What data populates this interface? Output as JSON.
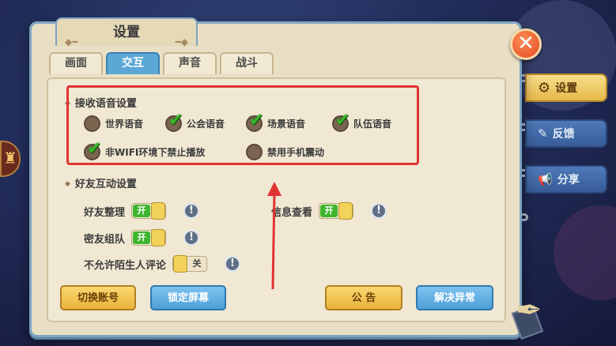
{
  "title": "设置",
  "tabs": [
    {
      "label": "画面",
      "active": false
    },
    {
      "label": "交互",
      "active": true
    },
    {
      "label": "声音",
      "active": false
    },
    {
      "label": "战斗",
      "active": false
    }
  ],
  "voice_section": {
    "title": "接收语音设置",
    "options": [
      {
        "label": "世界语音",
        "checked": false
      },
      {
        "label": "公会语音",
        "checked": true
      },
      {
        "label": "场景语音",
        "checked": true
      },
      {
        "label": "队伍语音",
        "checked": true
      },
      {
        "label": "非WIFI环境下禁止播放",
        "checked": true
      },
      {
        "label": "禁用手机震动",
        "checked": false
      }
    ]
  },
  "friend_section": {
    "title": "好友互动设置",
    "rows": [
      {
        "label": "好友整理",
        "state_label": "开",
        "on": true
      },
      {
        "label": "信息查看",
        "state_label": "开",
        "on": true
      },
      {
        "label": "密友组队",
        "state_label": "开",
        "on": true
      },
      {
        "label": "不允许陌生人评论",
        "state_label": "关",
        "on": false
      }
    ],
    "info_glyph": "!"
  },
  "buttons": {
    "switch_account": "切换账号",
    "lock_screen": "锁定屏幕",
    "announcement": "公 告",
    "fix_issue": "解决异常"
  },
  "side_tabs": [
    {
      "label": "设置",
      "icon": "gear-icon",
      "active": true
    },
    {
      "label": "反馈",
      "icon": "feedback-icon",
      "active": false
    },
    {
      "label": "分享",
      "icon": "megaphone-icon",
      "active": false
    }
  ],
  "close_glyph": "✕",
  "colors": {
    "highlight_box": "#e23232",
    "active_tab": "#5ba7d6",
    "toggle_on": "#3eb52e",
    "check": "#39b52c"
  }
}
